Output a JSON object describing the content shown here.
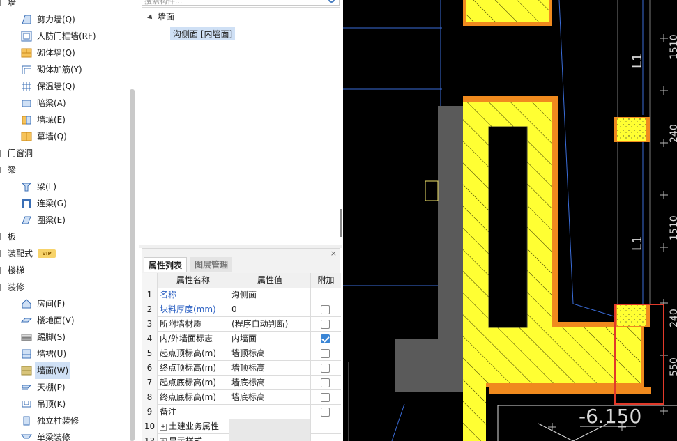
{
  "left_tree": {
    "items": [
      {
        "type": "cat",
        "label": "墙"
      },
      {
        "type": "leaf",
        "label": "剪力墙(Q)",
        "icon": "shear-wall-icon"
      },
      {
        "type": "leaf",
        "label": "人防门框墙(RF)",
        "icon": "civil-defense-door-wall-icon"
      },
      {
        "type": "leaf",
        "label": "砌体墙(Q)",
        "icon": "masonry-wall-icon"
      },
      {
        "type": "leaf",
        "label": "砌体加筋(Y)",
        "icon": "masonry-rebar-icon"
      },
      {
        "type": "leaf",
        "label": "保温墙(Q)",
        "icon": "insulation-wall-icon"
      },
      {
        "type": "leaf",
        "label": "暗梁(A)",
        "icon": "hidden-beam-icon"
      },
      {
        "type": "leaf",
        "label": "墙垛(E)",
        "icon": "wall-pier-icon"
      },
      {
        "type": "leaf",
        "label": "幕墙(Q)",
        "icon": "curtain-wall-icon"
      },
      {
        "type": "cat",
        "label": "门窗洞"
      },
      {
        "type": "cat",
        "label": "梁"
      },
      {
        "type": "leaf",
        "label": "梁(L)",
        "icon": "beam-icon"
      },
      {
        "type": "leaf",
        "label": "连梁(G)",
        "icon": "coupling-beam-icon"
      },
      {
        "type": "leaf",
        "label": "圈梁(E)",
        "icon": "ring-beam-icon"
      },
      {
        "type": "cat",
        "label": "板"
      },
      {
        "type": "cat",
        "label": "装配式",
        "badge": "VIP"
      },
      {
        "type": "cat",
        "label": "楼梯"
      },
      {
        "type": "cat",
        "label": "装修"
      },
      {
        "type": "leaf",
        "label": "房间(F)",
        "icon": "room-icon"
      },
      {
        "type": "leaf",
        "label": "楼地面(V)",
        "icon": "floor-icon"
      },
      {
        "type": "leaf",
        "label": "踢脚(S)",
        "icon": "skirting-icon"
      },
      {
        "type": "leaf",
        "label": "墙裙(U)",
        "icon": "dado-icon"
      },
      {
        "type": "leaf",
        "label": "墙面(W)",
        "icon": "wall-surface-icon",
        "selected": true
      },
      {
        "type": "leaf",
        "label": "天棚(P)",
        "icon": "ceiling-icon"
      },
      {
        "type": "leaf",
        "label": "吊顶(K)",
        "icon": "suspended-ceiling-icon"
      },
      {
        "type": "leaf",
        "label": "独立柱装修",
        "icon": "column-finish-icon"
      },
      {
        "type": "leaf",
        "label": "单梁装修",
        "icon": "beam-finish-icon"
      }
    ]
  },
  "component_panel": {
    "search_placeholder": "搜索构件...",
    "tree_root": "墙面",
    "tree_child": "沟侧面 [内墙面]"
  },
  "properties": {
    "tab_active": "属性列表",
    "tab_inactive": "图层管理",
    "close_label": "×",
    "headers": {
      "name": "属性名称",
      "value": "属性值",
      "add": "附加"
    },
    "rows": [
      {
        "num": "1",
        "name": "名称",
        "value": "沟侧面",
        "blue": true,
        "checkbox": false,
        "checked": false
      },
      {
        "num": "2",
        "name": "块料厚度(mm)",
        "value": "0",
        "blue": true,
        "checkbox": true,
        "checked": false
      },
      {
        "num": "3",
        "name": "所附墙材质",
        "value": "(程序自动判断)",
        "blue": false,
        "checkbox": true,
        "checked": false
      },
      {
        "num": "4",
        "name": "内/外墙面标志",
        "value": "内墙面",
        "blue": false,
        "checkbox": true,
        "checked": true
      },
      {
        "num": "5",
        "name": "起点顶标高(m)",
        "value": "墙顶标高",
        "blue": false,
        "checkbox": true,
        "checked": false
      },
      {
        "num": "6",
        "name": "终点顶标高(m)",
        "value": "墙顶标高",
        "blue": false,
        "checkbox": true,
        "checked": false
      },
      {
        "num": "7",
        "name": "起点底标高(m)",
        "value": "墙底标高",
        "blue": false,
        "checkbox": true,
        "checked": false
      },
      {
        "num": "8",
        "name": "终点底标高(m)",
        "value": "墙底标高",
        "blue": false,
        "checkbox": true,
        "checked": false
      },
      {
        "num": "9",
        "name": "备注",
        "value": "",
        "blue": false,
        "checkbox": true,
        "checked": false
      },
      {
        "num": "10",
        "name": "土建业务属性",
        "value": "",
        "group": true
      },
      {
        "num": "13",
        "name": "显示样式",
        "value": "",
        "group": true
      }
    ]
  },
  "cad": {
    "label_l1_top": "L1",
    "label_l1_mid": "L1",
    "label_1510_top": "1510",
    "label_1510_mid": "1510",
    "label_240_a": "240",
    "label_240_b": "240",
    "label_550": "550",
    "elevation_label": "-6.150",
    "colors": {
      "wall_fill": "#ffff33",
      "wall_outline": "#f08a1e",
      "pit_fill": "#5a5a5a",
      "highlight": "#e23a2a",
      "guide_line": "#3a6cd8"
    }
  }
}
